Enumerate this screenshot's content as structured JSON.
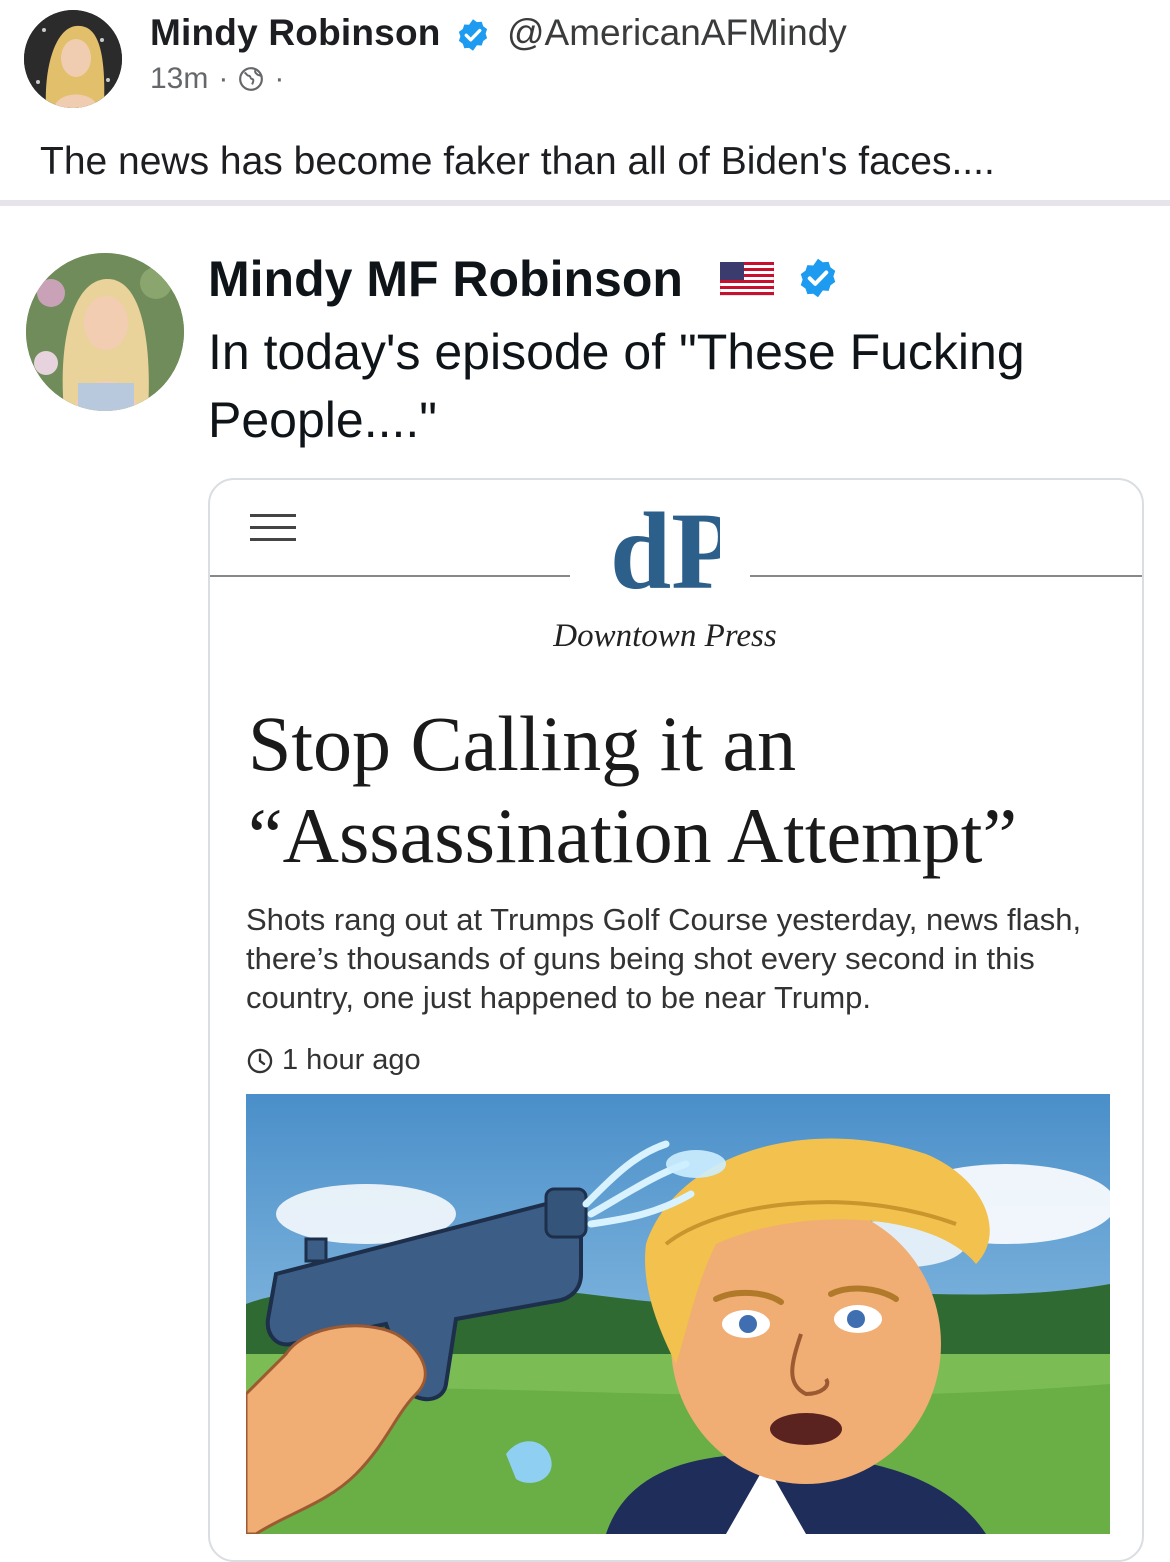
{
  "post": {
    "author_name": "Mindy Robinson",
    "author_handle": "@AmericanAFMindy",
    "time_ago": "13m",
    "separator": "·",
    "text": "The news has become faker than all of Biden's faces....",
    "icons": {
      "verified": "verified-badge-icon",
      "privacy": "globe-icon"
    }
  },
  "tweet": {
    "author_name": "Mindy MF Robinson",
    "text": "In today's episode of \"These Fucking People....\"",
    "icons": {
      "flag": "us-flag-icon",
      "verified": "verified-badge-icon"
    }
  },
  "article": {
    "logo_text": "dP",
    "publisher": "Downtown Press",
    "headline": "Stop Calling it an “Assassination Attempt”",
    "summary": "Shots rang out at Trumps Golf Course yesterday, news flash, there’s thousands of guns being shot every second in this country, one just happened to be near Trump.",
    "timestamp": "1 hour ago",
    "icons": {
      "menu": "hamburger-menu-icon",
      "clock": "clock-icon"
    },
    "image": "cartoon-water-pistol-illustration"
  },
  "colors": {
    "verified_blue": "#1d9bf0",
    "logo_blue": "#2c5f8a",
    "divider": "#e6e4ea"
  }
}
